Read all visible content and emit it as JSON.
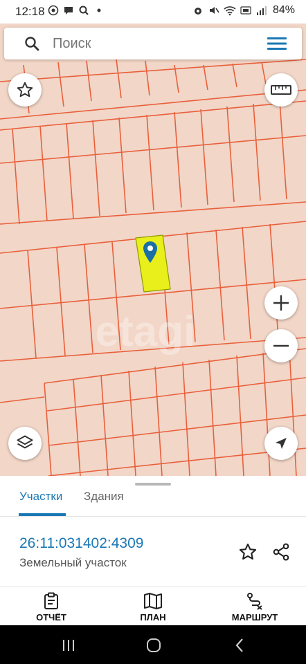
{
  "status_bar": {
    "time": "12:18",
    "battery": "84%",
    "left_icons": [
      "whatsapp-icon",
      "chat-icon",
      "search-icon",
      "dot-icon"
    ],
    "right_icons": [
      "alarm-icon",
      "mute-icon",
      "wifi-icon",
      "volte-icon",
      "signal-icon"
    ]
  },
  "search": {
    "placeholder": "Поиск"
  },
  "map": {
    "watermark": "etagi",
    "parcel_fill_color": "#e9ef1a",
    "parcel_line_color": "#e8603c",
    "background_color": "#f2d6c7",
    "controls": [
      "favorite-star",
      "ruler",
      "zoom-in",
      "zoom-out",
      "layers",
      "my-location"
    ]
  },
  "sheet": {
    "tabs": [
      {
        "label": "Участки",
        "active": true
      },
      {
        "label": "Здания",
        "active": false
      }
    ],
    "parcel_number": "26:11:031402:4309",
    "parcel_type": "Земельный участок",
    "accent_color": "#1a78b4"
  },
  "actions": [
    {
      "label": "ОТЧЁТ",
      "icon": "report-icon"
    },
    {
      "label": "ПЛАН",
      "icon": "map-plan-icon"
    },
    {
      "label": "МАРШРУТ",
      "icon": "route-icon"
    }
  ],
  "nav": {
    "buttons": [
      "recents",
      "home",
      "back"
    ]
  }
}
